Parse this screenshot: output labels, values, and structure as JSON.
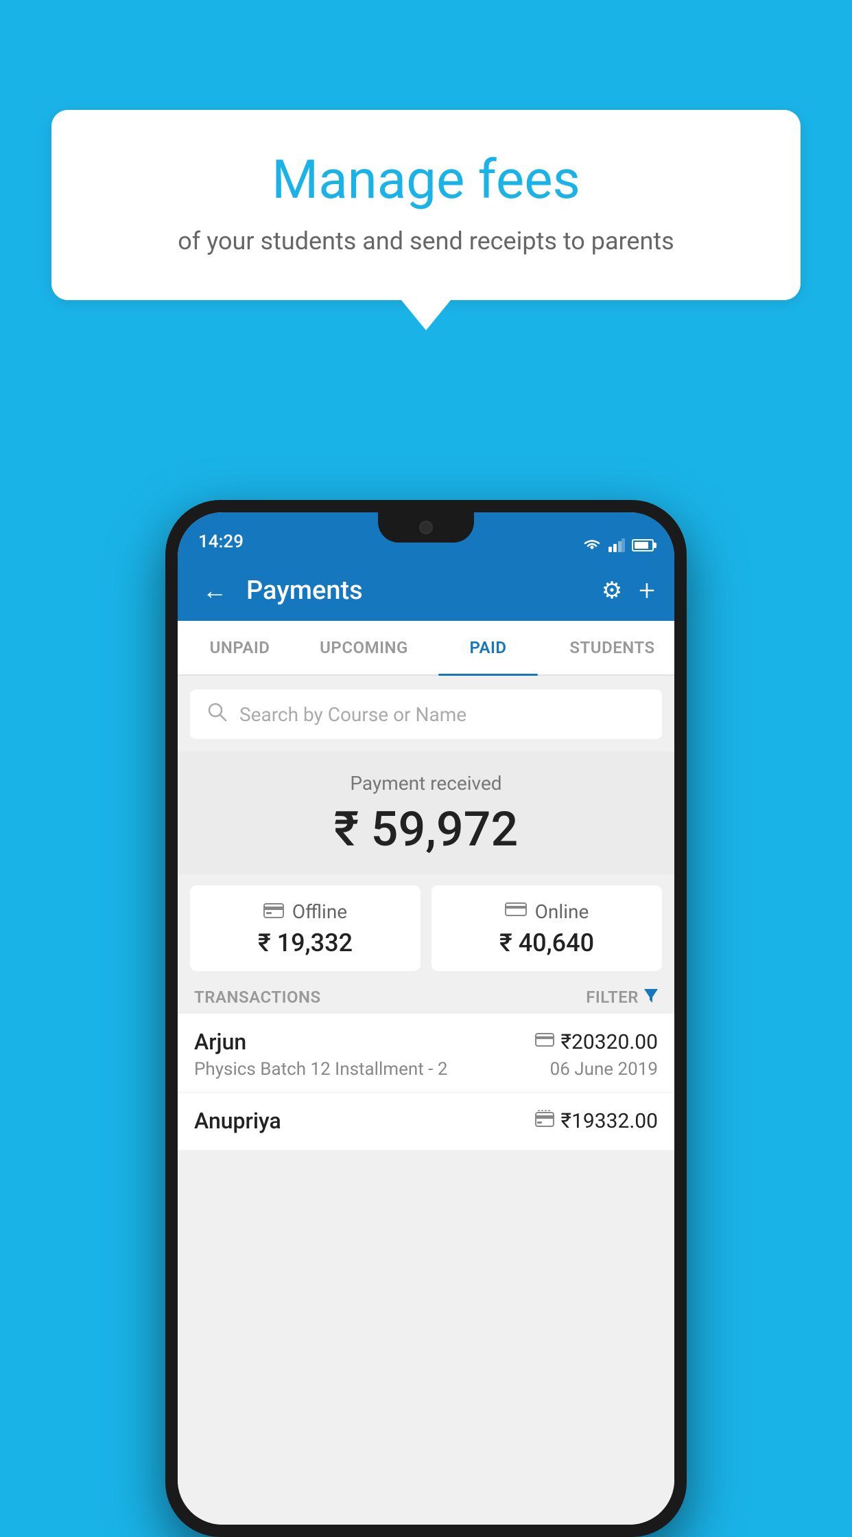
{
  "background_color": "#1ab3e8",
  "speech_bubble": {
    "title": "Manage fees",
    "subtitle": "of your students and send receipts to parents"
  },
  "status_bar": {
    "time": "14:29"
  },
  "app_header": {
    "title": "Payments",
    "back_label": "←",
    "settings_label": "⚙",
    "add_label": "+"
  },
  "tabs": [
    {
      "label": "UNPAID",
      "active": false
    },
    {
      "label": "UPCOMING",
      "active": false
    },
    {
      "label": "PAID",
      "active": true
    },
    {
      "label": "STUDENTS",
      "active": false
    }
  ],
  "search": {
    "placeholder": "Search by Course or Name"
  },
  "payment_summary": {
    "label": "Payment received",
    "amount": "₹ 59,972",
    "offline_label": "Offline",
    "offline_amount": "₹ 19,332",
    "online_label": "Online",
    "online_amount": "₹ 40,640"
  },
  "transactions_section": {
    "label": "TRANSACTIONS",
    "filter_label": "FILTER"
  },
  "transactions": [
    {
      "name": "Arjun",
      "course": "Physics Batch 12 Installment - 2",
      "amount": "₹20320.00",
      "date": "06 June 2019",
      "type": "online"
    },
    {
      "name": "Anupriya",
      "course": "",
      "amount": "₹19332.00",
      "date": "",
      "type": "offline"
    }
  ]
}
